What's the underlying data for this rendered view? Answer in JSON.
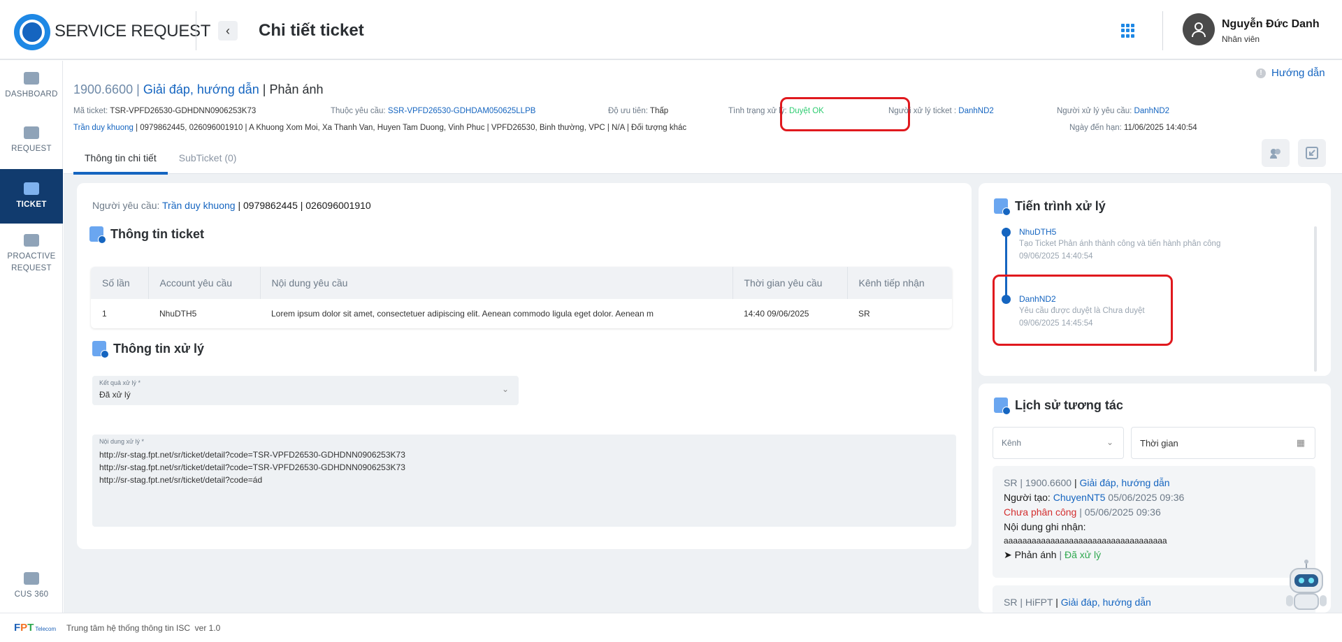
{
  "header": {
    "app_name": "SERVICE REQUEST",
    "page_title": "Chi tiết ticket",
    "user_name": "Nguyễn Đức Danh",
    "user_role": "Nhân viên"
  },
  "sidebar": {
    "items": [
      {
        "label": "DASHBOARD"
      },
      {
        "label": "REQUEST"
      },
      {
        "label": "TICKET"
      },
      {
        "label": "PROACTIVE REQUEST"
      },
      {
        "label": "CUS 360"
      }
    ]
  },
  "ticket": {
    "guide": "Hướng dẫn",
    "phone": "1900.6600",
    "category": "Giải đáp, hướng dẫn",
    "type": "Phản ánh",
    "sep": "|",
    "ma_ticket_label": "Mã ticket:",
    "ma_ticket": "TSR-VPFD26530-GDHDNN0906253K73",
    "thuoc_yeu_cau_label": "Thuộc yêu cầu:",
    "thuoc_yeu_cau": "SSR-VPFD26530-GDHDAM050625LLPB",
    "do_uu_tien_label": "Độ ưu tiên:",
    "do_uu_tien": "Thấp",
    "tinh_trang_label": "Tình trạng xử lý:",
    "tinh_trang": "Duyệt OK",
    "nguoi_xu_ly_ticket_label": "Người xử lý ticket :",
    "nguoi_xu_ly_ticket": "DanhND2",
    "nguoi_xu_ly_yeu_cau_label": "Người xử lý yêu cầu:",
    "nguoi_xu_ly_yeu_cau": "DanhND2",
    "customer_name": "Trần duy khuong",
    "customer_info": " | 0979862445, 026096001910 | A Khuong Xom Moi, Xa Thanh Van, Huyen Tam Duong, Vinh Phuc | VPFD26530, Binh thường, VPC | N/A | Đối tượng khác",
    "ngay_den_han_label": "Ngày đến hạn:",
    "ngay_den_han": "11/06/2025 14:40:54"
  },
  "tabs": [
    {
      "label": "Thông tin chi tiết"
    },
    {
      "label": "SubTicket (0)"
    }
  ],
  "detail": {
    "nguoi_yeu_cau_label": "Người yêu cầu:",
    "nguoi_yeu_cau_name": "Trần duy khuong",
    "nguoi_yeu_cau_info": " | 0979862445 | 026096001910",
    "thong_tin_ticket_title": "Thông tin ticket",
    "table": {
      "headers": [
        "Số lần",
        "Account yêu cầu",
        "Nội dung yêu cầu",
        "Thời gian yêu cầu",
        "Kênh tiếp nhận"
      ],
      "rows": [
        [
          "1",
          "NhuDTH5",
          "Lorem ipsum dolor sit amet, consectetuer adipiscing elit. Aenean commodo ligula eget dolor. Aenean m",
          "14:40 09/06/2025",
          "SR"
        ]
      ]
    },
    "thong_tin_xu_ly_title": "Thông tin xử lý",
    "ket_qua_label": "Kết quả xử lý *",
    "ket_qua_value": "Đã xử lý",
    "noi_dung_label": "Nội dung xử lý *",
    "noi_dung_lines": [
      "http://sr-stag.fpt.net/sr/ticket/detail?code=TSR-VPFD26530-GDHDNN0906253K73",
      "http://sr-stag.fpt.net/sr/ticket/detail?code=TSR-VPFD26530-GDHDNN0906253K73",
      "http://sr-stag.fpt.net/sr/ticket/detail?code=ád"
    ]
  },
  "progress": {
    "title": "Tiến trình xử lý",
    "items": [
      {
        "name": "NhuDTH5",
        "desc": "Tạo Ticket Phản ánh thành công và tiến hành phân công",
        "time": "09/06/2025 14:40:54"
      },
      {
        "name": "DanhND2",
        "desc": "Yêu cầu được duyệt là Chưa duyệt",
        "time": "09/06/2025 14:45:54"
      }
    ]
  },
  "history": {
    "title": "Lịch sử tương tác",
    "channel_placeholder": "Kênh",
    "time_placeholder": "Thời gian",
    "items": [
      {
        "source": "SR",
        "phone": "1900.6600",
        "category": "Giải đáp, hướng dẫn",
        "creator_label": "Người tạo:",
        "creator": "ChuyenNT5",
        "created_time": "05/06/2025 09:36",
        "status": "Chưa phân công",
        "status_time": "05/06/2025 09:36",
        "content_label": "Nội dung ghi nhận:",
        "content": "aaaaaaaaaaaaaaaaaaaaaaaaaaaaaaaaaaa",
        "type": "Phản ánh",
        "result": "Đã xử lý"
      },
      {
        "source": "SR",
        "phone": "HiFPT",
        "category": "Giải đáp, hướng dẫn"
      }
    ]
  },
  "footer": {
    "org": "Trung tâm hệ thống thông tin ISC",
    "version": "ver 1.0"
  }
}
